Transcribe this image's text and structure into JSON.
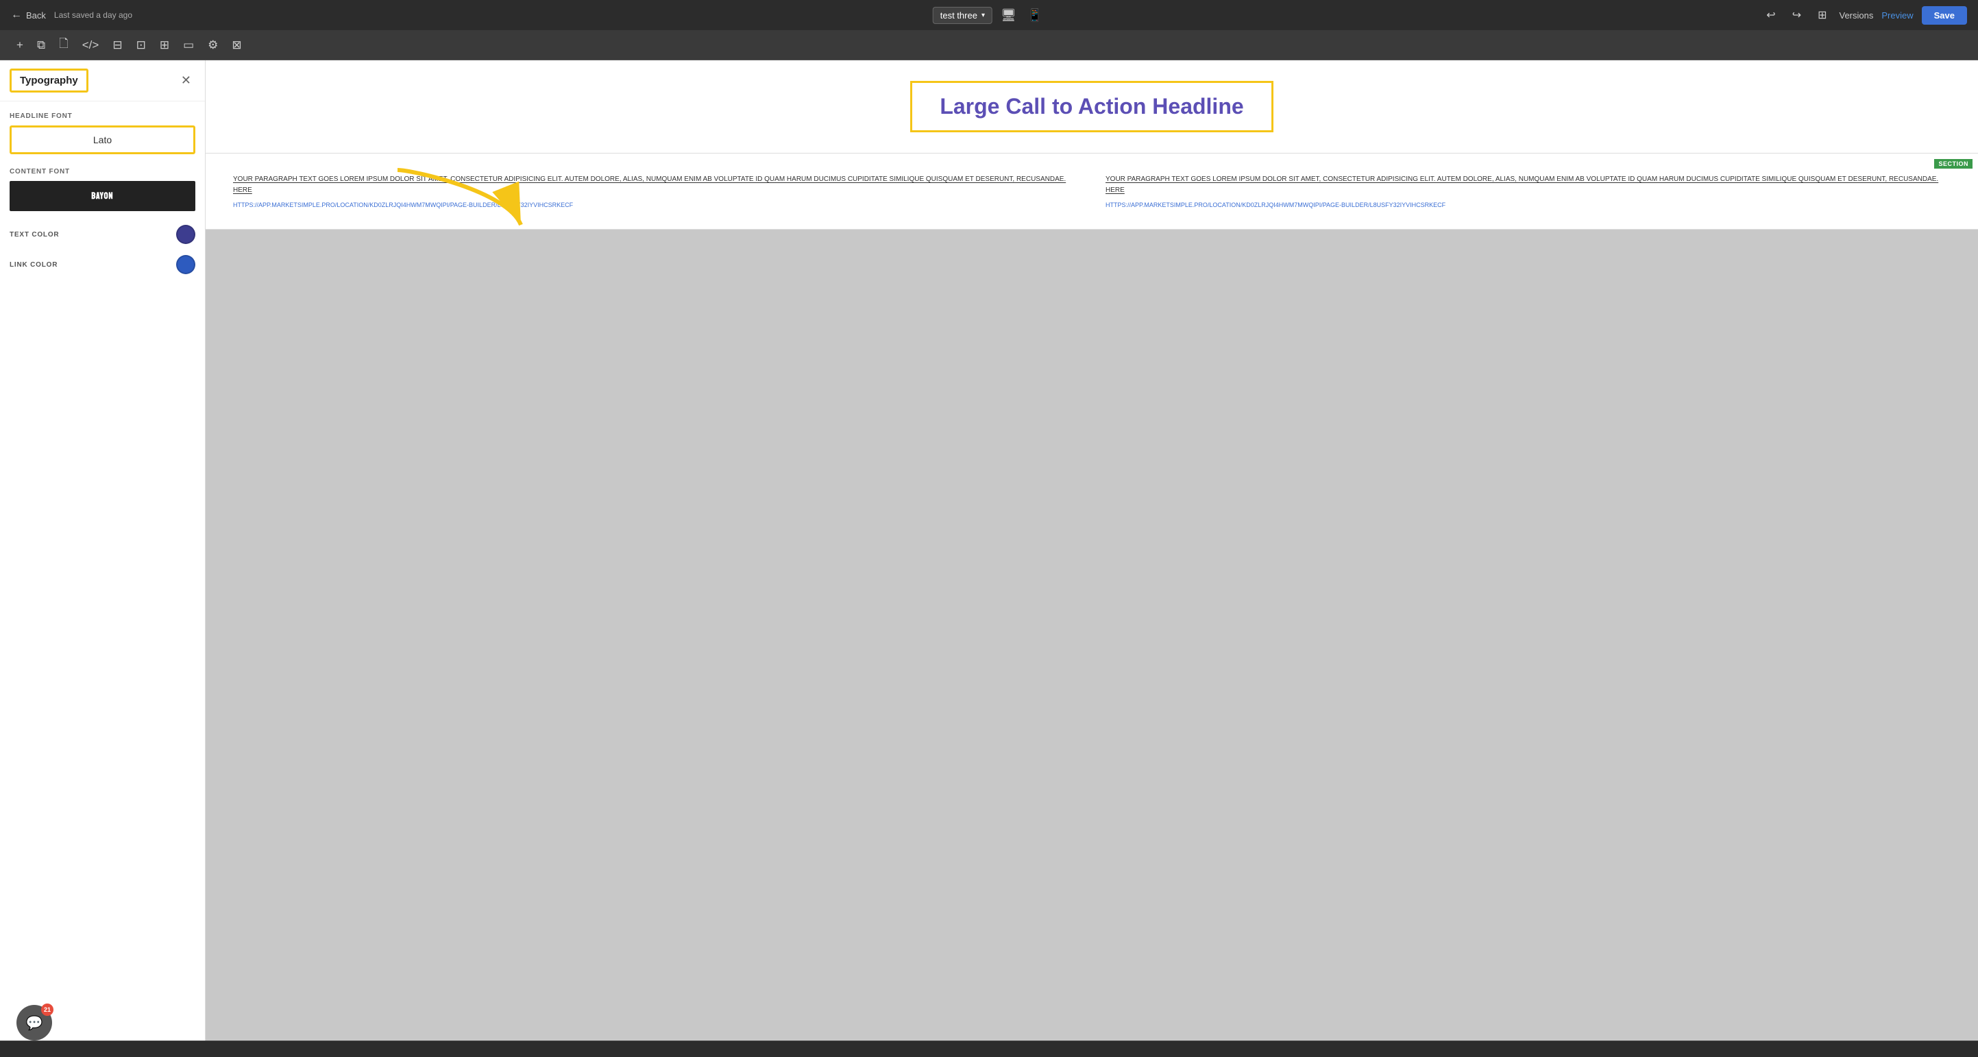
{
  "topNav": {
    "back_label": "Back",
    "last_saved": "Last saved a day ago",
    "project_name": "test three",
    "versions_label": "Versions",
    "preview_label": "Preview",
    "save_label": "Save"
  },
  "toolbar": {
    "icons": [
      {
        "name": "add-icon",
        "symbol": "+"
      },
      {
        "name": "layers-icon",
        "symbol": "⧉"
      },
      {
        "name": "pages-icon",
        "symbol": "🗋"
      },
      {
        "name": "code-icon",
        "symbol": "</>"
      },
      {
        "name": "templates-icon",
        "symbol": "⊞"
      },
      {
        "name": "components-icon",
        "symbol": "⊡"
      },
      {
        "name": "media-icon",
        "symbol": "⊟"
      },
      {
        "name": "layout-icon",
        "symbol": "▭"
      },
      {
        "name": "settings-icon",
        "symbol": "⊠"
      },
      {
        "name": "more-icon",
        "symbol": "⊞"
      }
    ]
  },
  "sidebar": {
    "title": "Typography",
    "headline_font_label": "HEADLINE FONT",
    "headline_font_value": "Lato",
    "content_font_label": "CONTENT FONT",
    "content_font_value": "BAYON",
    "text_color_label": "TEXT COLOR",
    "text_color_hex": "#3d3d8f",
    "link_color_label": "LINK COLOR",
    "link_color_hex": "#2d5bbf"
  },
  "canvas": {
    "headline_text": "Large Call to Action Headline",
    "paragraph_left": "YOUR PARAGRAPH TEXT GOES LOREM IPSUM DOLOR SIT AMET, CONSECTETUR ADIPISICING ELIT. AUTEM DOLORE, ALIAS, NUMQUAM ENIM AB VOLUPTATE ID QUAM HARUM DUCIMUS CUPIDITATE SIMILIQUE QUISQUAM ET DESERUNT, RECUSANDAE. HERE",
    "paragraph_right": "YOUR PARAGRAPH TEXT GOES LOREM IPSUM DOLOR SIT AMET, CONSECTETUR ADIPISICING ELIT. AUTEM DOLORE, ALIAS, NUMQUAM ENIM AB VOLUPTATE ID QUAM HARUM DUCIMUS CUPIDITATE SIMILIQUE QUISQUAM ET DESERUNT, RECUSANDAE. HERE",
    "url_left": "HTTPS://APP.MARKETSIMPLE.PRO/LOCATION/KD0ZLRJQI4HWM7MWQIPI/PAGE-BUILDER/L8USFY32IYVIHCSRKECF",
    "url_right": "HTTPS://APP.MARKETSIMPLE.PRO/LOCATION/KD0ZLRJQI4HWM7MWQIPI/PAGE-BUILDER/L8USFY32IYVIHCSRKECF",
    "section_label": "SECTION"
  },
  "chatWidget": {
    "badge_count": "21"
  }
}
